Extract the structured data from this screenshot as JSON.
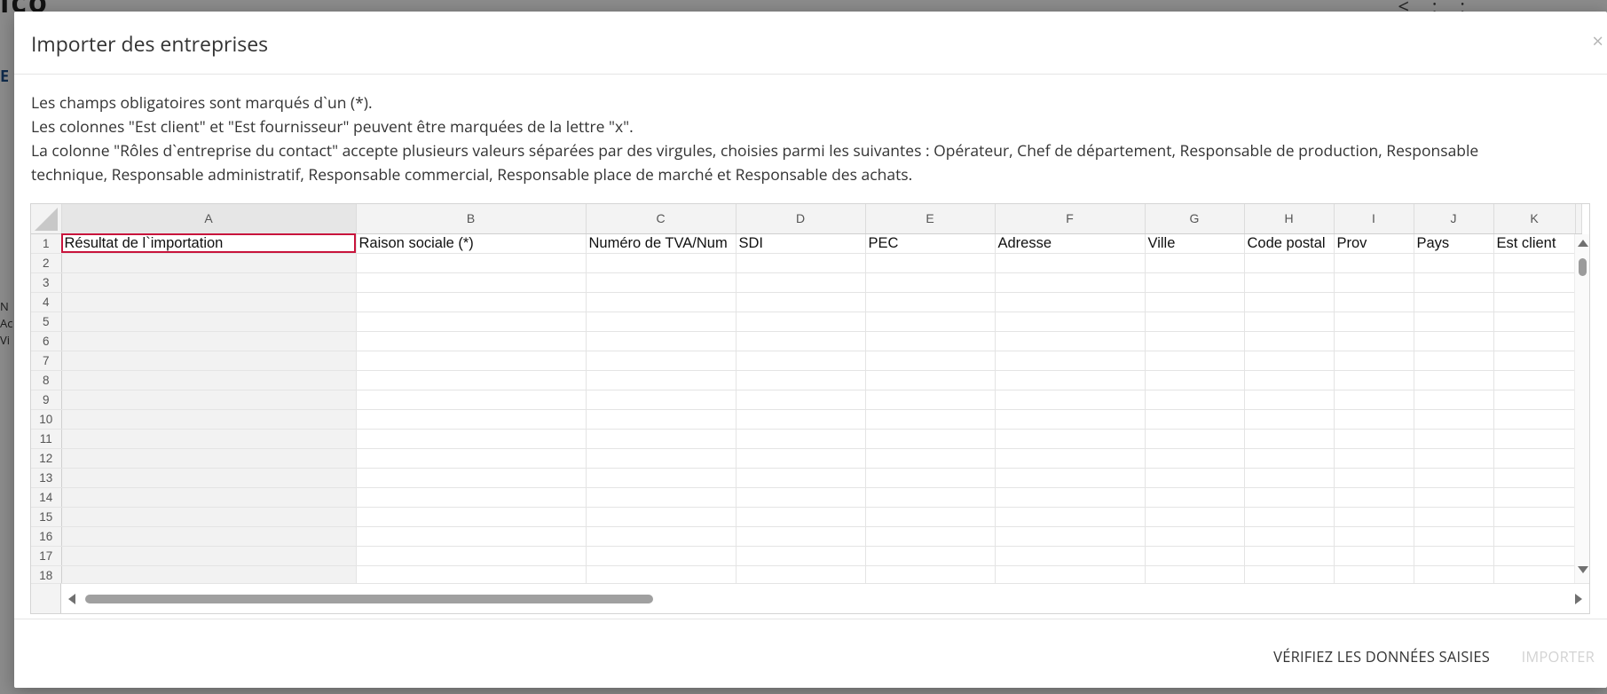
{
  "background": {
    "logo": "ico",
    "icons": "< : :",
    "tab_letter": "E",
    "card_lines": [
      "N",
      "Ac",
      "Vi"
    ]
  },
  "modal": {
    "title": "Importer des entreprises",
    "close_glyph": "×",
    "instructions": [
      "Les champs obligatoires sont marqués d`un (*).",
      "Les colonnes \"Est client\" et \"Est fournisseur\" peuvent être marquées de la lettre \"x\".",
      "La colonne \"Rôles d`entreprise du contact\" accepte plusieurs valeurs séparées par des virgules, choisies parmi les suivantes : Opérateur, Chef de département, Responsable de production, Responsable technique, Responsable administratif, Responsable commercial, Responsable place de marché et Responsable des achats."
    ]
  },
  "sheet": {
    "columns": [
      "A",
      "B",
      "C",
      "D",
      "E",
      "F",
      "G",
      "H",
      "I",
      "J",
      "K"
    ],
    "header_row": [
      "Résultat de l`importation",
      "Raison sociale (*)",
      "Numéro de TVA/Num",
      "SDI",
      "PEC",
      "Adresse",
      "Ville",
      "Code postal",
      "Prov",
      "Pays",
      "Est client"
    ],
    "row_numbers": [
      "1",
      "2",
      "3",
      "4",
      "5",
      "6",
      "7",
      "8",
      "9",
      "10",
      "11",
      "12",
      "13",
      "14",
      "15",
      "16",
      "17",
      "18"
    ]
  },
  "footer": {
    "verify_label": "VÉRIFIEZ LES DONNÉES SAISIES",
    "import_label": "IMPORTER"
  }
}
